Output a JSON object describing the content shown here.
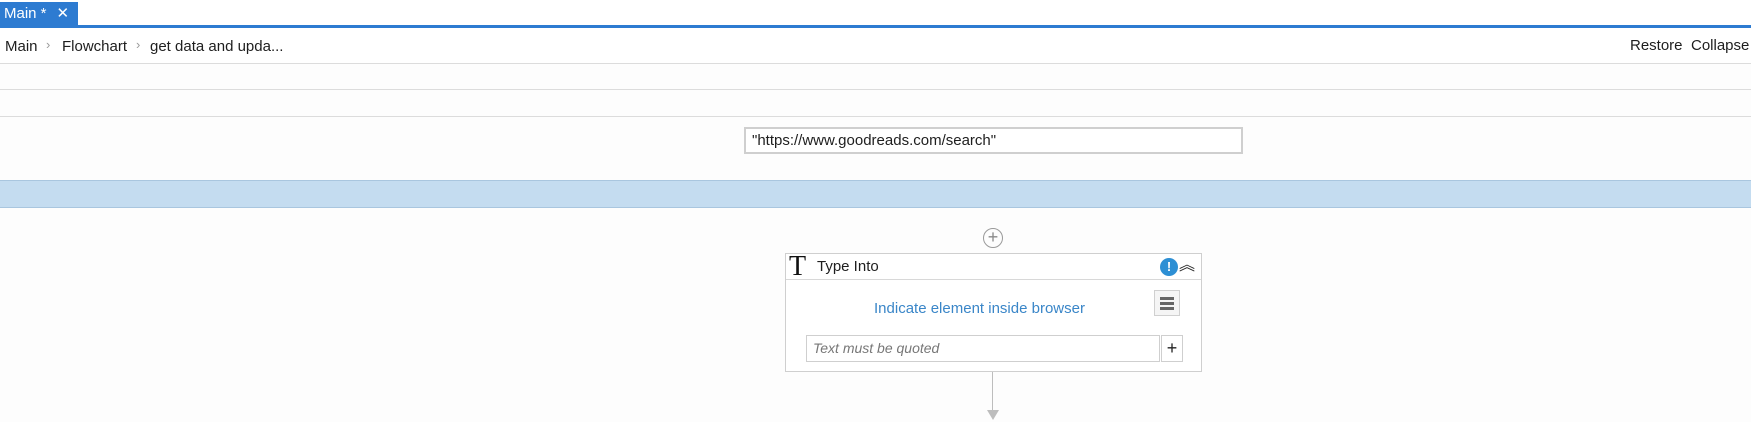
{
  "tab": {
    "label": "Main *",
    "close_glyph": "✕"
  },
  "breadcrumb": {
    "items": [
      "Main",
      "Flowchart",
      "get data and upda..."
    ],
    "separator": "›"
  },
  "toolbar": {
    "restore_label": "Restore",
    "collapse_label": "Collapse"
  },
  "url_field": {
    "value": "\"https://www.goodreads.com/search\""
  },
  "add_activity": {
    "glyph": "+"
  },
  "activity": {
    "icon_glyph": "T",
    "title": "Type Into",
    "warning_glyph": "!",
    "collapse_glyph": "︽",
    "indicate_link": "Indicate element inside browser",
    "text_placeholder": "Text must be quoted",
    "plus_glyph": "+"
  },
  "colors": {
    "accent": "#2d7bd1",
    "selection": "#c4dcf0",
    "link": "#3a86c8",
    "warning": "#2d8fd4"
  }
}
